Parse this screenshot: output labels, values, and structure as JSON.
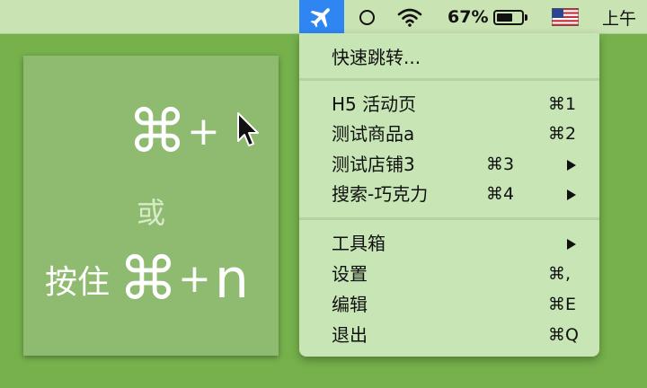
{
  "menubar": {
    "battery_percent": "67%",
    "battery_level": 0.67,
    "time": "上午"
  },
  "hint": {
    "cmd_glyph_top": "⌘",
    "plus_top": "+",
    "or_text": "或",
    "hold_label": "按住",
    "cmd_glyph_bottom": "⌘",
    "plus_bottom": "+",
    "key": "n"
  },
  "menu": {
    "quick_jump": "快速跳转...",
    "items": [
      {
        "label": "H5 活动页",
        "shortcut": "⌘1"
      },
      {
        "label": "测试商品a",
        "shortcut": "⌘2"
      },
      {
        "label": "测试店铺3",
        "shortcut": "⌘3"
      },
      {
        "label": "搜索-巧克力",
        "shortcut": "⌘4"
      }
    ],
    "tools": "工具箱",
    "settings": {
      "label": "设置",
      "shortcut": "⌘,"
    },
    "edit": {
      "label": "编辑",
      "shortcut": "⌘E"
    },
    "quit": {
      "label": "退出",
      "shortcut": "⌘Q"
    }
  },
  "colors": {
    "desktop": "#76b14c",
    "menubar": "#c9e3b3",
    "app_highlight": "#2f86f2",
    "dropdown": "#c8e5b6",
    "hint_panel": "#8fbb70"
  },
  "icons": {
    "app": "airplane-icon",
    "status": "circle-icon",
    "wifi": "wifi-icon",
    "battery": "battery-icon",
    "input_source": "us-flag-icon",
    "pointer": "cursor-icon"
  }
}
